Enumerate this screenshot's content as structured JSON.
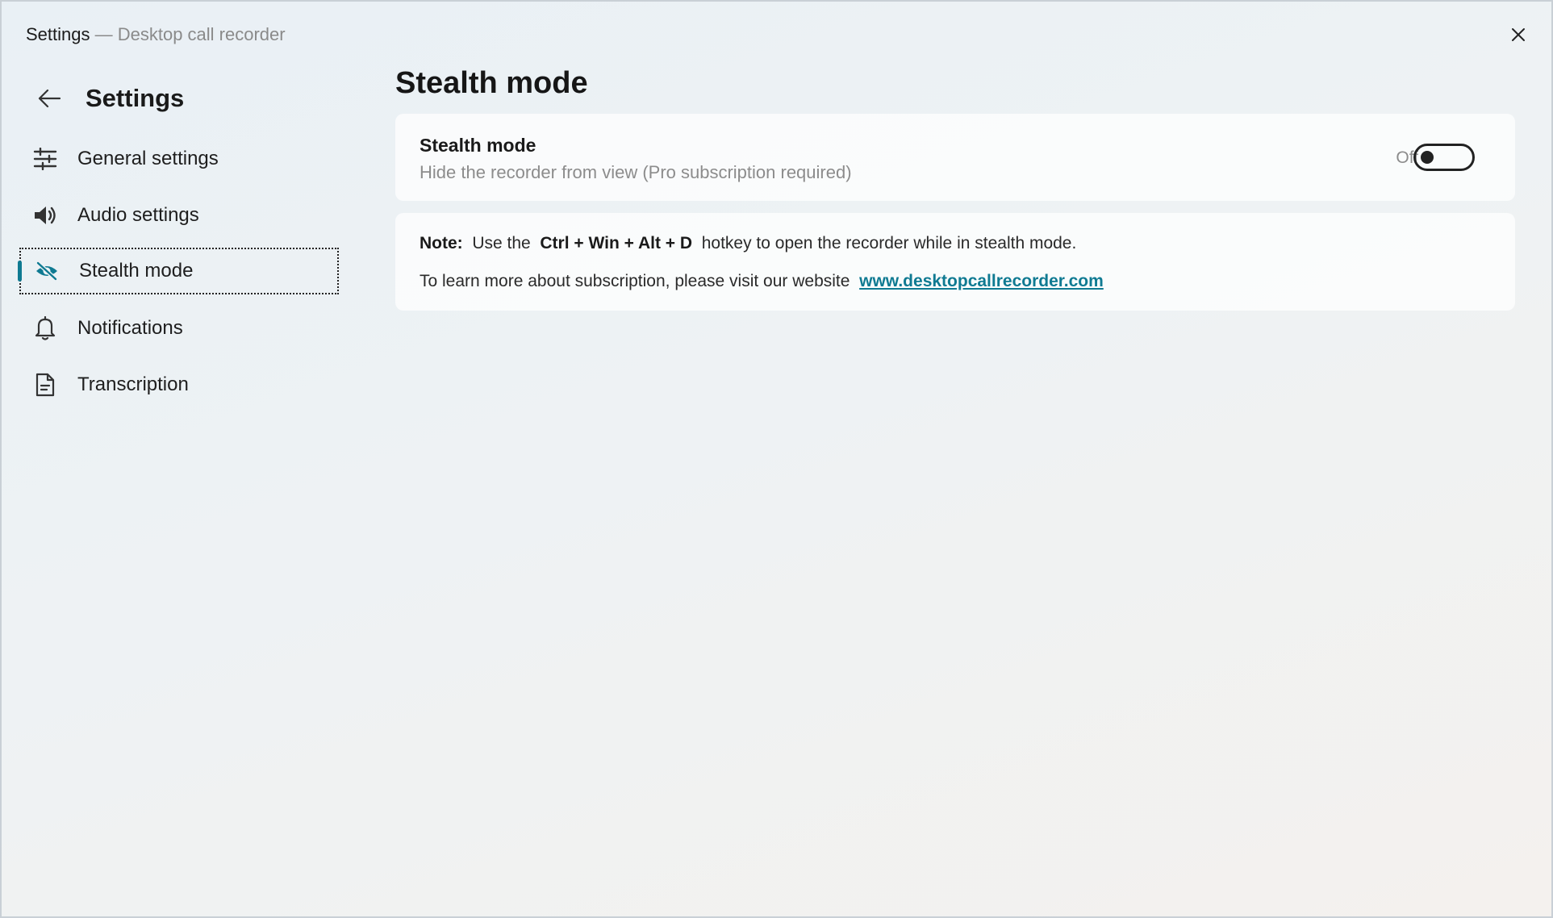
{
  "window": {
    "title_app": "Settings",
    "title_separator": " — ",
    "title_subtitle": "Desktop call recorder"
  },
  "sidebar": {
    "title": "Settings",
    "items": [
      {
        "label": "General settings",
        "icon": "sliders-icon"
      },
      {
        "label": "Audio settings",
        "icon": "speaker-icon"
      },
      {
        "label": "Stealth mode",
        "icon": "eye-off-icon",
        "active": true
      },
      {
        "label": "Notifications",
        "icon": "bell-icon"
      },
      {
        "label": "Transcription",
        "icon": "document-icon"
      }
    ]
  },
  "main": {
    "page_title": "Stealth mode",
    "stealth_card": {
      "title": "Stealth mode",
      "description": "Hide the recorder from view (Pro subscription required)",
      "toggle_state": "Off",
      "toggle_on": false
    },
    "note_card": {
      "note_label": "Note:",
      "note_pre": "Use the",
      "hotkey": "Ctrl + Win + Alt + D",
      "note_post": "hotkey to open the recorder while in stealth mode.",
      "learn_more": "To learn more about subscription, please visit our website",
      "website_link": "www.desktopcallrecorder.com"
    }
  },
  "colors": {
    "accent": "#0f7a92",
    "text": "#1a1a1a",
    "muted": "#8c8c8c"
  }
}
